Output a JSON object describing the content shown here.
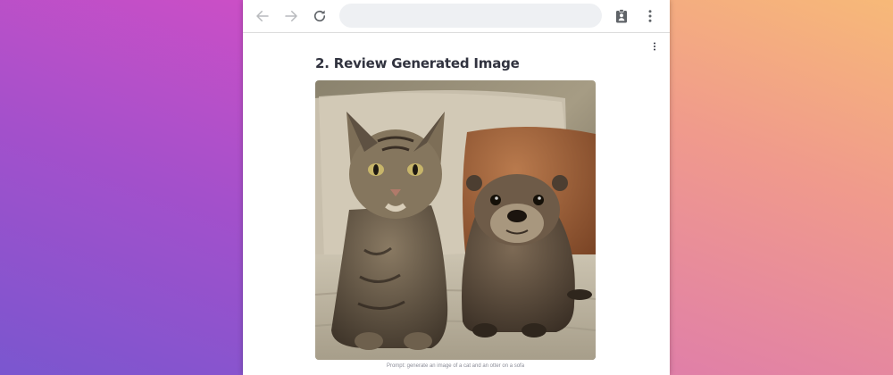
{
  "browser": {
    "address_value": "",
    "icons": {
      "back": "arrow-left-icon",
      "forward": "arrow-right-icon",
      "reload": "reload-icon",
      "extension": "clipboard-user-icon",
      "menu": "kebab-menu-icon"
    }
  },
  "page": {
    "title": "2. Review Generated Image",
    "image_alt": "A cat and an otter on a sofa",
    "caption": "Prompt: generate an image of a cat and an otter on a sofa",
    "menu_icon": "kebab-menu-icon"
  },
  "colors": {
    "title_text": "#31333f",
    "caption_text": "#8b8d98",
    "toolbar_icon": "#5f6368",
    "address_bar": "#eef0f3"
  }
}
